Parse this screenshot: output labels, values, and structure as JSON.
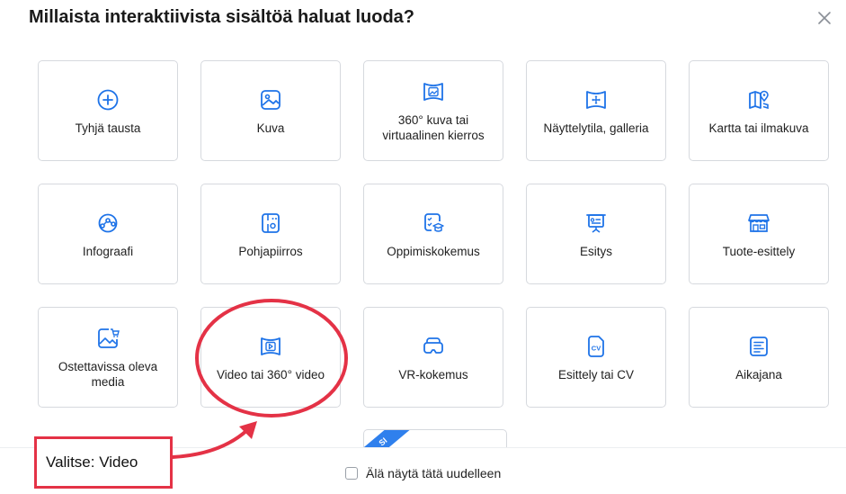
{
  "dialog": {
    "title": "Millaista interaktiivista sisältöä haluat luoda?",
    "close_icon": "close-icon"
  },
  "cards": [
    {
      "label": "Tyhjä tausta",
      "icon": "plus-circle-icon"
    },
    {
      "label": "Kuva",
      "icon": "image-icon"
    },
    {
      "label": "360° kuva tai virtuaalinen kierros",
      "icon": "panorama-image-icon"
    },
    {
      "label": "Näyttelytila, galleria",
      "icon": "gallery-move-icon"
    },
    {
      "label": "Kartta tai ilmakuva",
      "icon": "map-pin-icon"
    },
    {
      "label": "Infograafi",
      "icon": "infographic-icon"
    },
    {
      "label": "Pohjapiirros",
      "icon": "floorplan-icon"
    },
    {
      "label": "Oppimiskokemus",
      "icon": "learning-icon"
    },
    {
      "label": "Esitys",
      "icon": "presentation-icon"
    },
    {
      "label": "Tuote-esittely",
      "icon": "store-icon"
    },
    {
      "label": "Ostettavissa oleva media",
      "icon": "cart-image-icon"
    },
    {
      "label": "Video tai 360° video",
      "icon": "video-play-icon"
    },
    {
      "label": "VR-kokemus",
      "icon": "vr-headset-icon"
    },
    {
      "label": "Esittely tai CV",
      "icon": "cv-document-icon"
    },
    {
      "label": "Aikajana",
      "icon": "timeline-icon"
    }
  ],
  "partial_card": {
    "badge": "SI"
  },
  "footer": {
    "checkbox_label": "Älä näytä tätä uudelleen",
    "checked": false
  },
  "annotation": {
    "callout_text": "Valitse: Video",
    "color": "#e43246"
  },
  "colors": {
    "accent": "#1e73e8",
    "ribbon": "#2f80ed"
  }
}
